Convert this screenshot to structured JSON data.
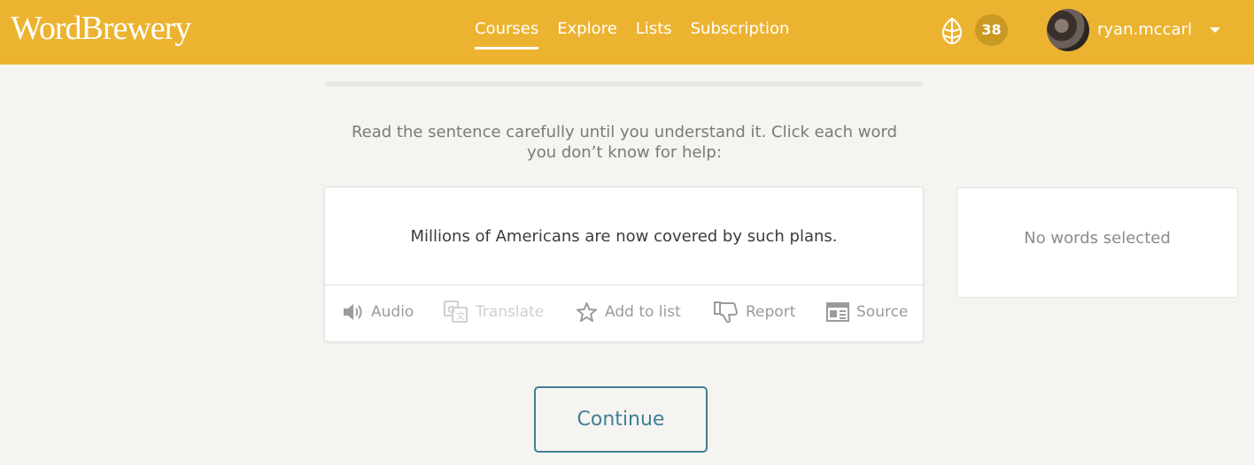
{
  "brand": {
    "logo_text": "WordBrewery"
  },
  "nav": {
    "items": [
      {
        "label": "Courses",
        "active": true
      },
      {
        "label": "Explore",
        "active": false
      },
      {
        "label": "Lists",
        "active": false
      },
      {
        "label": "Subscription",
        "active": false
      }
    ]
  },
  "user": {
    "hops_count": "38",
    "username": "ryan.mccarl",
    "hops_icon": "hop-icon"
  },
  "lesson": {
    "instruction": "Read the sentence carefully until you understand it. Click each word you don’t know for help:",
    "sentence": "Millions of Americans are now covered by such plans.",
    "actions": [
      {
        "label": "Audio",
        "icon": "speaker-icon",
        "enabled": true
      },
      {
        "label": "Translate",
        "icon": "translate-icon",
        "enabled": false
      },
      {
        "label": "Add to list",
        "icon": "star-icon",
        "enabled": true
      },
      {
        "label": "Report",
        "icon": "thumbs-down-icon",
        "enabled": true
      },
      {
        "label": "Source",
        "icon": "newspaper-icon",
        "enabled": true
      }
    ]
  },
  "sidebar": {
    "empty_text": "No words selected"
  },
  "footer": {
    "continue_label": "Continue"
  },
  "colors": {
    "header": "#ecb330",
    "accent": "#3f7f95",
    "background": "#f5f4f0"
  }
}
